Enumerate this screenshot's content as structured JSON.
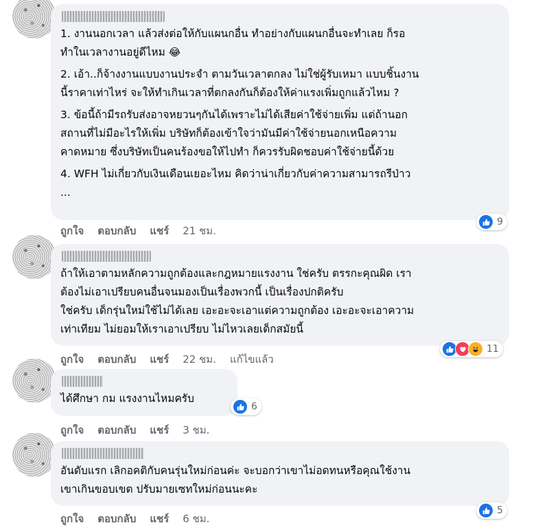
{
  "actions": {
    "like": "ถูกใจ",
    "reply": "ตอบกลับ",
    "share": "แชร์"
  },
  "comments": [
    {
      "paragraphs": [
        "1. งานนอกเวลา แล้วส่งต่อให้กับแผนกอื่น ทำอย่างกับแผนกอื่นจะทำเลย ก็รอ\nทำในเวลางานอยู่ดีไหม",
        "2. เอ้า..ก็จ้างงานแบบงานประจำ ตามวันเวลาตกลง ไม่ใช่ผู้รับเหมา แบบชิ้นงาน\nนี้ราคาเท่าไหร่ จะให้ทำเกินเวลาที่ตกลงกันก็ต้องให้ค่าแรงเพิ่มถูกแล้วไหม ?",
        "3. ข้อนี้ถ้ามีรถรับส่งอาจหยวนๆกันได้เพราะไม่ได้เสียค่าใช้จ่ายเพิ่ม แต่ถ้านอก\nสถานที่ไม่มีอะไรให้เพิ่ม บริษัทก็ต้องเข้าใจว่ามันมีค่าใช้จ่ายนอกเหนือความ\nคาดหมาย ซึ่งบริษัทเป็นคนร้องขอให้ไปทำ ก็ควรรับผิดชอบค่าใช้จ่ายนี้ด้วย",
        "4. WFH ไม่เกี่ยวกับเงินเดือนเยอะไหม คิดว่าน่าเกี่ยวกับค่าความสามารถรีป่าว\n..."
      ],
      "emoji": "😂",
      "time": "21 ชม.",
      "edited": "",
      "reaction_count": "9",
      "reactions": [
        "like"
      ]
    },
    {
      "paragraphs": [
        "ถ้าให้เอาตามหลักความถูกต้องและกฎหมายแรงงาน ใช่ครับ ตรรกะคุณผิด เรา\nต้องไม่เอาเปรียบคนอื่นจนมองเป็นเรื่องพวกนี้ เป็นเรื่องปกติครับ\nใช่ครับ เด็กรุ่นใหม่ใช้ไม่ได้เลย เอะอะจะเอาแต่ความถูกต้อง เอะอะจะเอาความ\nเท่าเทียม ไม่ยอมให้เราเอาเปรียบ ไม่ไหวเลยเด็กสมัยนี้"
      ],
      "time": "22 ชม.",
      "edited": "แก้ไขแล้ว",
      "reaction_count": "11",
      "reactions": [
        "like",
        "love",
        "haha"
      ]
    },
    {
      "paragraphs": [
        "ได้ศึกษา กม แรงงานไหมครับ"
      ],
      "time": "3 ชม.",
      "edited": "",
      "reaction_count": "6",
      "reactions": [
        "like"
      ]
    },
    {
      "paragraphs": [
        "อันดับแรก เลิกอคติกับคนรุ่นใหม่ก่อนค่ะ จะบอกว่าเขาไม่อดทนหรือคุณใช้งาน\nเขาเกินขอบเขต ปรับมายเซทใหม่ก่อนนะคะ"
      ],
      "time": "6 ชม.",
      "edited": "",
      "reaction_count": "5",
      "reactions": [
        "like"
      ]
    }
  ]
}
